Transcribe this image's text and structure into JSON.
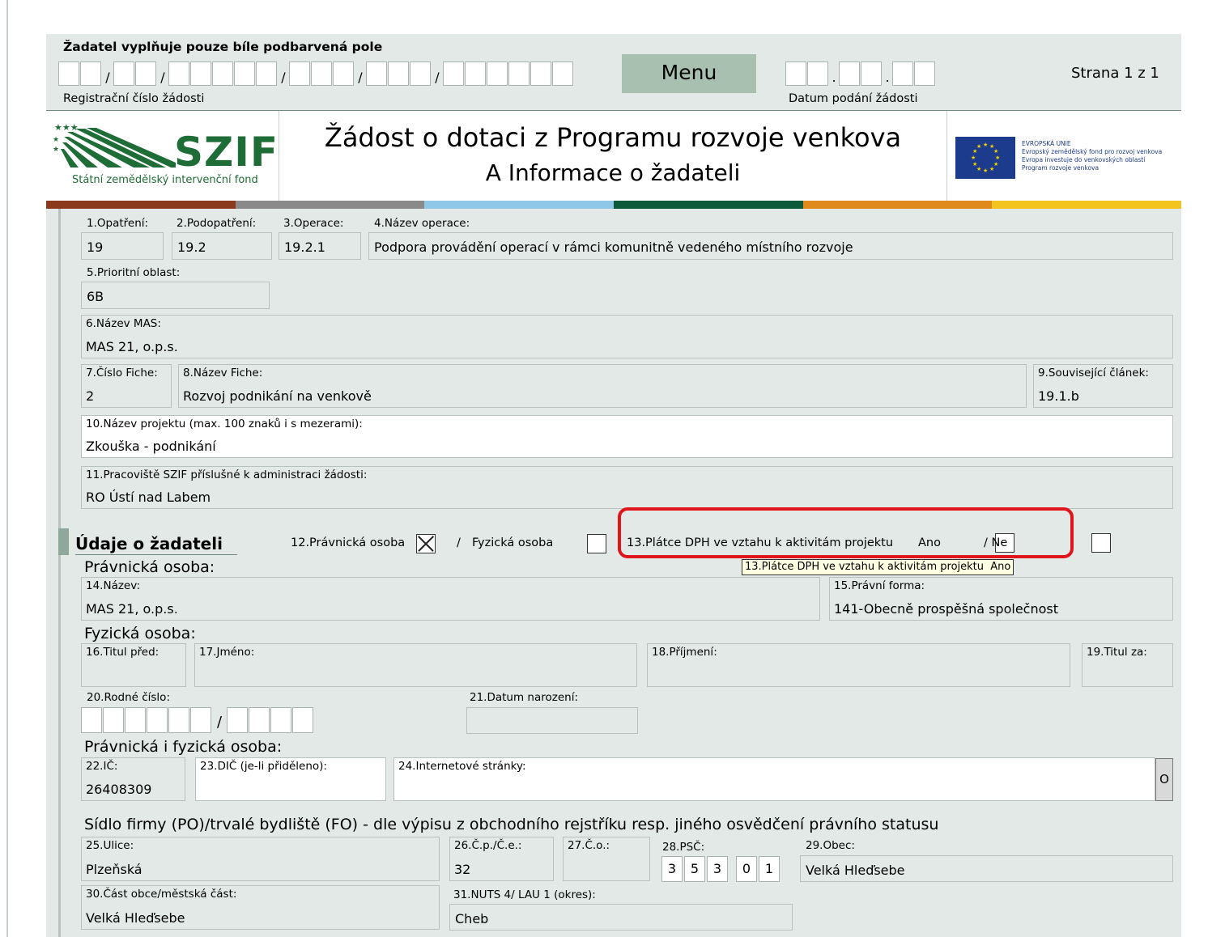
{
  "header": {
    "instruction": "Žadatel vyplňuje pouze bíle podbarvená pole",
    "reg_label": "Registrační číslo žádosti",
    "reg_sep": "/",
    "date_sep": ".",
    "menu": "Menu",
    "date_label": "Datum podání žádosti",
    "page_info": "Strana 1 z 1"
  },
  "banner": {
    "logo_text": "SZIF",
    "logo_sub": "Státní zemědělský intervenční fond",
    "title": "Žádost o dotaci z Programu rozvoje venkova",
    "subtitle": "A Informace o žadateli",
    "eu_lines": [
      "EVROPSKÁ UNIE",
      "Evropský zemědělský fond pro rozvoj venkova",
      "Evropa investuje do venkovských oblastí",
      "Program rozvoje venkova"
    ],
    "stripe_colors": [
      "#8b3b1b",
      "#8a8a8a",
      "#8ec7e8",
      "#0d5a3b",
      "#e08a1e",
      "#f2c41d"
    ]
  },
  "fields": {
    "f1": {
      "label": "1.Opatření:",
      "value": "19"
    },
    "f2": {
      "label": "2.Podopatření:",
      "value": "19.2"
    },
    "f3": {
      "label": "3.Operace:",
      "value": "19.2.1"
    },
    "f4": {
      "label": "4.Název operace:",
      "value": "Podpora provádění operací v rámci komunitně vedeného místního rozvoje"
    },
    "f5": {
      "label": "5.Prioritní oblast:",
      "value": "6B"
    },
    "f6": {
      "label": "6.Název MAS:",
      "value": "MAS 21, o.p.s."
    },
    "f7": {
      "label": "7.Číslo Fiche:",
      "value": "2"
    },
    "f8": {
      "label": "8.Název Fiche:",
      "value": "Rozvoj podnikání na venkově"
    },
    "f9": {
      "label": "9.Související článek:",
      "value": "19.1.b"
    },
    "f10": {
      "label": "10.Název projektu (max. 100 znaků i s mezerami):",
      "value": "Zkouška - podnikání"
    },
    "f11": {
      "label": "11.Pracoviště SZIF příslušné k administraci žádosti:",
      "value": "RO Ústí nad Labem"
    },
    "f14": {
      "label": "14.Název:",
      "value": "MAS 21, o.p.s."
    },
    "f15": {
      "label": "15.Právní forma:",
      "value": "141-Obecně prospěšná společnost"
    },
    "f16": {
      "label": "16.Titul před:",
      "value": ""
    },
    "f17": {
      "label": "17.Jméno:",
      "value": ""
    },
    "f18": {
      "label": "18.Příjmení:",
      "value": ""
    },
    "f19": {
      "label": "19.Titul za:",
      "value": ""
    },
    "f20": {
      "label": "20.Rodné číslo:"
    },
    "f21": {
      "label": "21.Datum narození:",
      "value": ""
    },
    "f22": {
      "label": "22.IČ:",
      "value": "26408309"
    },
    "f23": {
      "label": "23.DIČ (je-li přiděleno):",
      "value": ""
    },
    "f24": {
      "label": "24.Internetové stránky:",
      "value": "",
      "button": "O"
    },
    "f25": {
      "label": "25.Ulice:",
      "value": "Plzeňská"
    },
    "f26": {
      "label": "26.Č.p./Č.e.:",
      "value": "32"
    },
    "f27": {
      "label": "27.Č.o.:",
      "value": ""
    },
    "f28": {
      "label": "28.PSČ:",
      "digits": [
        "3",
        "5",
        "3",
        "0",
        "1"
      ]
    },
    "f29": {
      "label": "29.Obec:",
      "value": "Velká Hleďsebe"
    },
    "f30": {
      "label": "30.Část obce/městská část:",
      "value": "Velká Hleďsebe"
    },
    "f31": {
      "label": "31.NUTS 4/ LAU 1 (okres):",
      "value": "Cheb"
    }
  },
  "applicant": {
    "heading": "Údaje o žadateli",
    "f12_label": "12.Právnická osoba",
    "f12_checked": true,
    "slash": "/",
    "fo_label": "Fyzická osoba",
    "fo_checked": false,
    "f13_label": "13.Plátce DPH ve vztahu k aktivitám projektu",
    "ano": "Ano",
    "ne": "/ Ne",
    "tooltip": "13.Plátce DPH ve vztahu k aktivitám projektu  Ano",
    "highlight_color": "#e0141b"
  },
  "sections": {
    "po": "Právnická osoba:",
    "fo": "Fyzická osoba:",
    "both": "Právnická i fyzická osoba:",
    "seat": "Sídlo firmy (PO)/trvalé bydliště (FO) - dle výpisu z obchodního rejstříku resp. jiného osvědčení právního statusu"
  }
}
